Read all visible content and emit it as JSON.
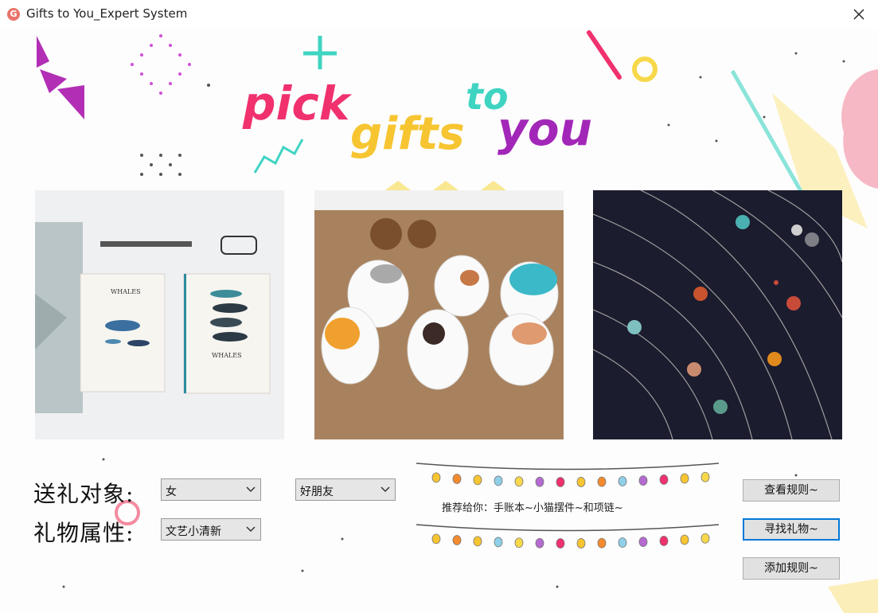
{
  "window": {
    "title": "Gifts to You_Expert System",
    "icon": "g-app-icon"
  },
  "banner": {
    "words": [
      "pick",
      "gifts",
      "to",
      "you"
    ],
    "colors": [
      "#f0316e",
      "#f7c531",
      "#3fd4c2",
      "#a227b8"
    ]
  },
  "photos": [
    "notebook-photo",
    "cat-figurines-photo",
    "planet-necklace-photo"
  ],
  "form": {
    "target_label": "送礼对象:",
    "attribute_label": "礼物属性:",
    "gender_value": "女",
    "relation_value": "好朋友",
    "attribute_value": "文艺小清新"
  },
  "recommendation": {
    "text": "推荐给你：手账本~小猫摆件~和项链~"
  },
  "buttons": {
    "view_rules": "查看规则~",
    "find_gift": "寻找礼物~",
    "add_rule": "添加规则~"
  }
}
